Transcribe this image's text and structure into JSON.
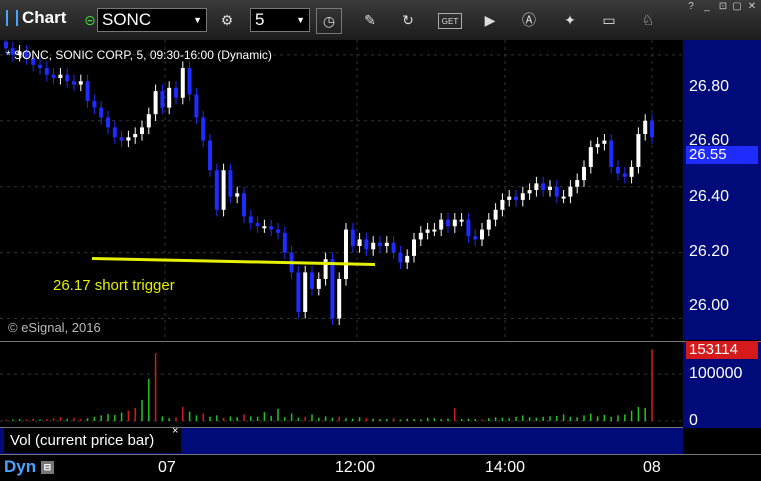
{
  "toolbar": {
    "app_title": "Chart",
    "symbol": "SONC",
    "interval": "5",
    "get_label": "GET"
  },
  "chart": {
    "title": "* SONC, SONIC CORP, 5, 09:30-16:00 (Dynamic)",
    "copyright": "© eSignal, 2016",
    "annotation": "26.17 short trigger",
    "price_ticks": [
      "26.80",
      "26.60",
      "26.40",
      "26.20",
      "26.00"
    ],
    "current_price": "26.55",
    "volume_ticks": [
      "100000",
      "0"
    ],
    "current_volume": "153114",
    "volume_panel_label": "Vol (current price bar)",
    "time_ticks": [
      "07",
      "12:00",
      "14:00",
      "08"
    ],
    "dyn_label": "Dyn",
    "colors": {
      "up": "#ffffff",
      "down": "#1f2cff",
      "trigger_line": "#e4f000",
      "axis_bg": "#000a78",
      "vol_up": "#22c422",
      "vol_down": "#d41a1a"
    }
  },
  "chart_data": {
    "type": "candlestick",
    "title": "* SONC, SONIC CORP, 5, 09:30-16:00 (Dynamic)",
    "ylim": [
      25.95,
      26.83
    ],
    "yticks": [
      26.0,
      26.2,
      26.4,
      26.6,
      26.8
    ],
    "trigger_level": 26.17,
    "last_price": 26.55,
    "candles": [
      [
        26.84,
        26.82
      ],
      [
        26.82,
        26.8
      ],
      [
        26.8,
        26.81
      ],
      [
        26.81,
        26.79
      ],
      [
        26.79,
        26.77
      ],
      [
        26.77,
        26.76
      ],
      [
        26.76,
        26.74
      ],
      [
        26.74,
        26.73
      ],
      [
        26.73,
        26.74
      ],
      [
        26.74,
        26.72
      ],
      [
        26.72,
        26.71
      ],
      [
        26.71,
        26.72
      ],
      [
        26.72,
        26.66
      ],
      [
        26.66,
        26.64
      ],
      [
        26.64,
        26.61
      ],
      [
        26.61,
        26.58
      ],
      [
        26.58,
        26.55
      ],
      [
        26.55,
        26.54
      ],
      [
        26.54,
        26.55
      ],
      [
        26.55,
        26.56
      ],
      [
        26.56,
        26.58
      ],
      [
        26.58,
        26.62
      ],
      [
        26.62,
        26.69
      ],
      [
        26.69,
        26.64
      ],
      [
        26.64,
        26.7
      ],
      [
        26.7,
        26.67
      ],
      [
        26.67,
        26.76
      ],
      [
        26.76,
        26.68
      ],
      [
        26.68,
        26.61
      ],
      [
        26.61,
        26.54
      ],
      [
        26.54,
        26.45
      ],
      [
        26.45,
        26.33
      ],
      [
        26.33,
        26.45
      ],
      [
        26.45,
        26.37
      ],
      [
        26.37,
        26.38
      ],
      [
        26.38,
        26.31
      ],
      [
        26.31,
        26.29
      ],
      [
        26.29,
        26.28
      ],
      [
        26.28,
        26.28
      ],
      [
        26.28,
        26.27
      ],
      [
        26.27,
        26.26
      ],
      [
        26.26,
        26.2
      ],
      [
        26.2,
        26.14
      ],
      [
        26.14,
        26.02
      ],
      [
        26.02,
        26.14
      ],
      [
        26.14,
        26.09
      ],
      [
        26.09,
        26.12
      ],
      [
        26.12,
        26.18
      ],
      [
        26.18,
        26.0
      ],
      [
        26.0,
        26.12
      ],
      [
        26.12,
        26.27
      ],
      [
        26.27,
        26.22
      ],
      [
        26.22,
        26.24
      ],
      [
        26.24,
        26.21
      ],
      [
        26.21,
        26.23
      ],
      [
        26.23,
        26.22
      ],
      [
        26.22,
        26.23
      ],
      [
        26.23,
        26.2
      ],
      [
        26.2,
        26.17
      ],
      [
        26.17,
        26.19
      ],
      [
        26.19,
        26.24
      ],
      [
        26.24,
        26.26
      ],
      [
        26.26,
        26.27
      ],
      [
        26.27,
        26.27
      ],
      [
        26.27,
        26.3
      ],
      [
        26.3,
        26.28
      ],
      [
        26.28,
        26.3
      ],
      [
        26.3,
        26.3
      ],
      [
        26.3,
        26.25
      ],
      [
        26.25,
        26.24
      ],
      [
        26.24,
        26.27
      ],
      [
        26.27,
        26.3
      ],
      [
        26.3,
        26.33
      ],
      [
        26.33,
        26.36
      ],
      [
        26.36,
        26.37
      ],
      [
        26.37,
        26.36
      ],
      [
        26.36,
        26.38
      ],
      [
        26.38,
        26.39
      ],
      [
        26.39,
        26.41
      ],
      [
        26.41,
        26.39
      ],
      [
        26.39,
        26.4
      ],
      [
        26.4,
        26.37
      ],
      [
        26.37,
        26.37
      ],
      [
        26.37,
        26.4
      ],
      [
        26.4,
        26.42
      ],
      [
        26.42,
        26.46
      ],
      [
        26.46,
        26.52
      ],
      [
        26.52,
        26.53
      ],
      [
        26.53,
        26.54
      ],
      [
        26.54,
        26.46
      ],
      [
        26.46,
        26.44
      ],
      [
        26.44,
        26.43
      ],
      [
        26.43,
        26.46
      ],
      [
        26.46,
        26.56
      ],
      [
        26.56,
        26.6
      ],
      [
        26.6,
        26.55
      ]
    ],
    "volume_ylim": [
      0,
      160000
    ],
    "volume_yticks": [
      0,
      100000
    ],
    "last_volume": 153114,
    "volumes": [
      [
        2000,
        0
      ],
      [
        3000,
        1
      ],
      [
        4000,
        1
      ],
      [
        3000,
        0
      ],
      [
        5000,
        0
      ],
      [
        3000,
        1
      ],
      [
        4000,
        0
      ],
      [
        6000,
        0
      ],
      [
        8000,
        0
      ],
      [
        5000,
        1
      ],
      [
        7000,
        0
      ],
      [
        4000,
        0
      ],
      [
        6000,
        1
      ],
      [
        9000,
        1
      ],
      [
        12000,
        1
      ],
      [
        15000,
        1
      ],
      [
        13000,
        1
      ],
      [
        18000,
        1
      ],
      [
        22000,
        0
      ],
      [
        28000,
        0
      ],
      [
        45000,
        1
      ],
      [
        90000,
        1
      ],
      [
        145000,
        0
      ],
      [
        10000,
        1
      ],
      [
        6000,
        1
      ],
      [
        8000,
        0
      ],
      [
        30000,
        0
      ],
      [
        20000,
        1
      ],
      [
        12000,
        1
      ],
      [
        16000,
        0
      ],
      [
        9000,
        1
      ],
      [
        12000,
        1
      ],
      [
        7000,
        0
      ],
      [
        10000,
        1
      ],
      [
        8000,
        1
      ],
      [
        14000,
        0
      ],
      [
        10000,
        1
      ],
      [
        9000,
        1
      ],
      [
        19000,
        1
      ],
      [
        11000,
        1
      ],
      [
        26000,
        1
      ],
      [
        8000,
        1
      ],
      [
        16000,
        1
      ],
      [
        7000,
        1
      ],
      [
        9000,
        0
      ],
      [
        14000,
        1
      ],
      [
        7000,
        1
      ],
      [
        10000,
        1
      ],
      [
        7000,
        1
      ],
      [
        9000,
        0
      ],
      [
        6000,
        1
      ],
      [
        5000,
        1
      ],
      [
        8000,
        1
      ],
      [
        6000,
        0
      ],
      [
        5000,
        1
      ],
      [
        4000,
        1
      ],
      [
        4000,
        1
      ],
      [
        6000,
        0
      ],
      [
        3000,
        1
      ],
      [
        5000,
        1
      ],
      [
        4000,
        1
      ],
      [
        3000,
        1
      ],
      [
        7000,
        1
      ],
      [
        6000,
        1
      ],
      [
        4000,
        1
      ],
      [
        5000,
        1
      ],
      [
        28000,
        0
      ],
      [
        4000,
        1
      ],
      [
        5000,
        1
      ],
      [
        4000,
        1
      ],
      [
        3000,
        0
      ],
      [
        6000,
        1
      ],
      [
        8000,
        1
      ],
      [
        7000,
        1
      ],
      [
        6000,
        1
      ],
      [
        9000,
        1
      ],
      [
        12000,
        1
      ],
      [
        8000,
        1
      ],
      [
        7000,
        1
      ],
      [
        9000,
        1
      ],
      [
        10000,
        1
      ],
      [
        11000,
        1
      ],
      [
        14000,
        1
      ],
      [
        9000,
        1
      ],
      [
        8000,
        1
      ],
      [
        12000,
        1
      ],
      [
        16000,
        1
      ],
      [
        10000,
        1
      ],
      [
        13000,
        1
      ],
      [
        9000,
        1
      ],
      [
        12000,
        1
      ],
      [
        14000,
        1
      ],
      [
        22000,
        1
      ],
      [
        30000,
        1
      ],
      [
        28000,
        1
      ],
      [
        153114,
        0
      ]
    ]
  }
}
